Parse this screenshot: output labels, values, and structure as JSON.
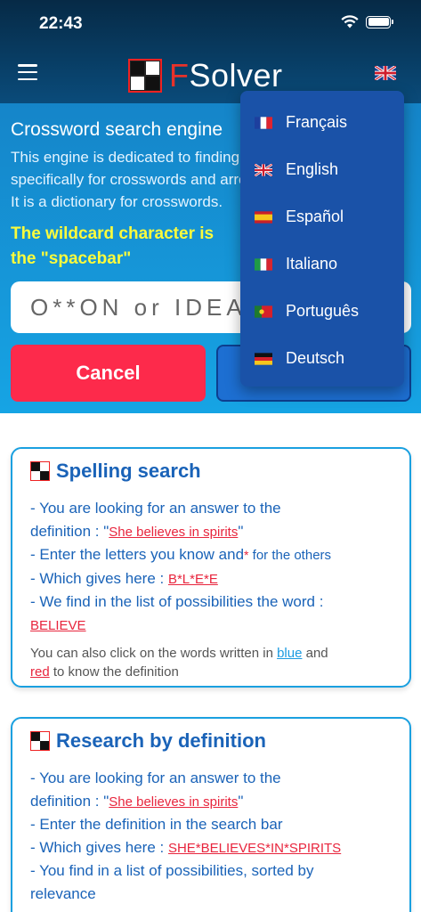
{
  "status": {
    "time": "22:43"
  },
  "brand": {
    "f": "F",
    "rest": "Solver"
  },
  "hero": {
    "title": "Crossword search engine",
    "desc_lines": [
      "This engine is dedicated to finding words",
      "specifically for crosswords and arrow words.",
      "It is a dictionary for crosswords."
    ],
    "wildcard_line1": "The wildcard character is",
    "wildcard_line2": "the \"spacebar\""
  },
  "search": {
    "placeholder": "O**ON or IDEA",
    "cancel_label": "Cancel"
  },
  "languages": [
    {
      "label": "Français",
      "flag": "fr"
    },
    {
      "label": "English",
      "flag": "gb"
    },
    {
      "label": "Español",
      "flag": "es"
    },
    {
      "label": "Italiano",
      "flag": "it"
    },
    {
      "label": "Português",
      "flag": "pt"
    },
    {
      "label": "Deutsch",
      "flag": "de"
    }
  ],
  "card1": {
    "title": "Spelling search",
    "l1": "- You are looking for an answer to the",
    "l2a": "definition : \"",
    "l2link": "She believes in spirits",
    "l2b": "\"",
    "l3a": "- Enter the letters you know and",
    "l3star": "*",
    "l3b": " for the others",
    "l4a": "- Which gives here : ",
    "l4link": "B*L*E*E",
    "l5": "- We find in the list of possibilities the word :",
    "l6link": "BELIEVE",
    "note_a": "You can also click on the words written in ",
    "note_blue": "blue",
    "note_b": " and",
    "note_red": "red",
    "note_c": " to know the definition"
  },
  "card2": {
    "title": "Research by definition",
    "l1": "- You are looking for an answer to the",
    "l2a": "definition : \"",
    "l2link": "She believes in spirits",
    "l2b": "\"",
    "l3": "- Enter the definition in the search bar",
    "l4a": "- Which gives here : ",
    "l4link": "SHE*BELIEVES*IN*SPIRITS",
    "l5": "- You find in a list of possibilities, sorted by",
    "l6": "relevance"
  },
  "colors": {
    "accent_red": "#fd2a4b",
    "brand_blue": "#1a63b8",
    "menu_bg": "#1a52a8",
    "wildcard_yellow": "#fbfb3c"
  }
}
